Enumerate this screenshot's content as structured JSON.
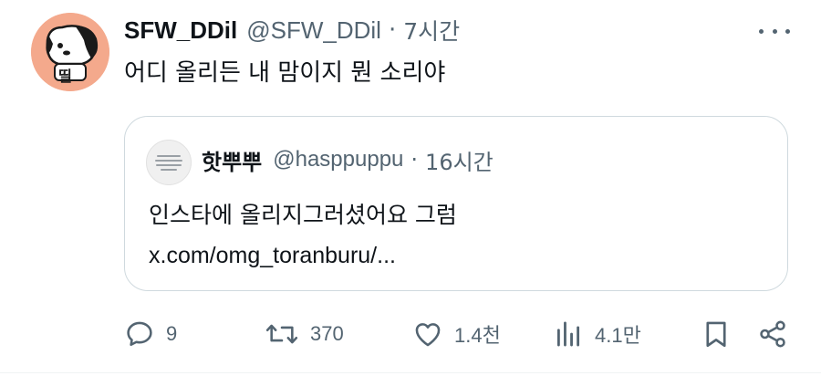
{
  "tweet": {
    "display_name": "SFW_DDil",
    "handle": "@SFW_DDil",
    "separator": "·",
    "time": "7시간",
    "text": "어디 올리든 내 맘이지 뭔 소리야",
    "avatar_label": "띨"
  },
  "quoted": {
    "display_name": "핫뿌뿌",
    "handle": "@hasppuppu",
    "separator": "·",
    "time": "16시간",
    "text_line1": "인스타에 올리지그러셨어요 그럼",
    "link": "x.com/omg_toranburu/..."
  },
  "actions": {
    "reply_count": "9",
    "retweet_count": "370",
    "like_count": "1.4천",
    "views_count": "4.1만"
  },
  "colors": {
    "text_primary": "#0f1419",
    "text_secondary": "#536471",
    "border": "#cfd9de",
    "avatar_bg": "#f4a98c"
  },
  "icons": [
    "more-icon",
    "reply-icon",
    "retweet-icon",
    "like-icon",
    "views-icon",
    "bookmark-icon",
    "share-icon"
  ]
}
